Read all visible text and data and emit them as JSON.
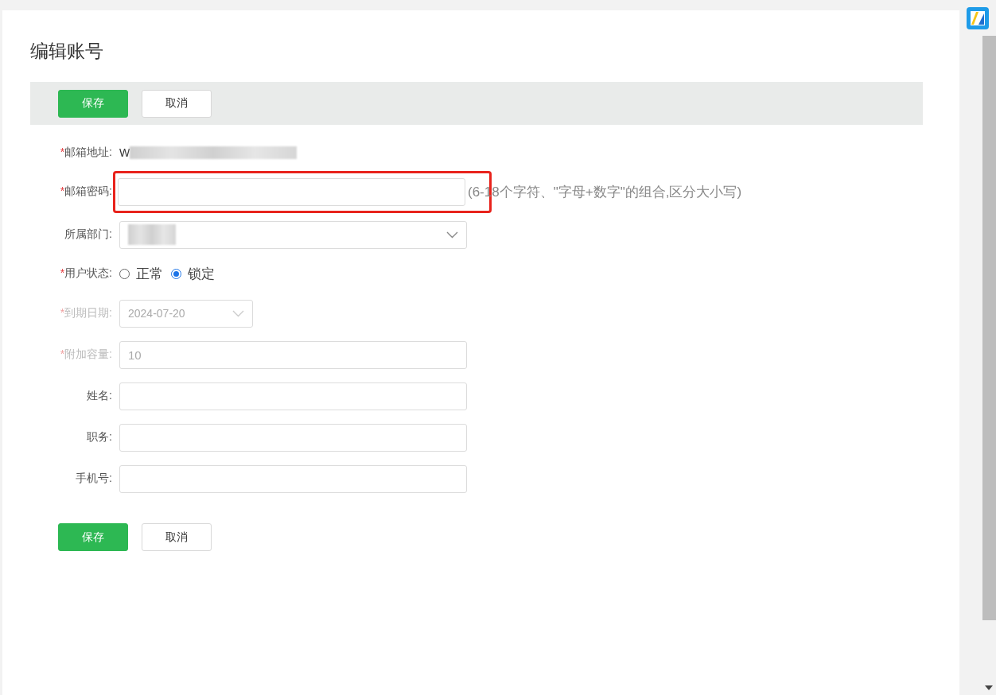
{
  "title": "编辑账号",
  "top_buttons": [
    {
      "label": "保存",
      "kind": "primary"
    },
    {
      "label": "取消",
      "kind": "default"
    }
  ],
  "fields": [
    {
      "kind": "text",
      "label": "邮箱地址:",
      "required_mark": "*",
      "disabled": false,
      "value": "W",
      "redacted": true
    },
    {
      "kind": "input",
      "label": "邮箱密码:",
      "required_mark": "*",
      "disabled": false,
      "highlighted": true,
      "hint": "(6-18个字符、\"字母+数字\"的组合,区分大小写)"
    },
    {
      "kind": "select",
      "label": "所属部门:",
      "disabled": false,
      "redacted": true
    },
    {
      "kind": "radio",
      "label": "用户状态:",
      "required_mark": "*",
      "disabled": false,
      "options": [
        {
          "label": "正常",
          "selected": false
        },
        {
          "label": "锁定",
          "selected": true
        }
      ]
    },
    {
      "kind": "date",
      "label": "到期日期:",
      "required_mark": "*",
      "disabled": true,
      "value": "2024-07-20"
    },
    {
      "kind": "input",
      "label": "附加容量:",
      "required_mark": "*",
      "disabled": true,
      "value": "10"
    },
    {
      "kind": "input",
      "label": "姓名:",
      "disabled": false
    },
    {
      "kind": "input",
      "label": "职务:",
      "disabled": false
    },
    {
      "kind": "input",
      "label": "手机号:",
      "disabled": false
    }
  ],
  "bottom_buttons": [
    {
      "label": "保存",
      "kind": "primary"
    },
    {
      "label": "取消",
      "kind": "default"
    }
  ]
}
